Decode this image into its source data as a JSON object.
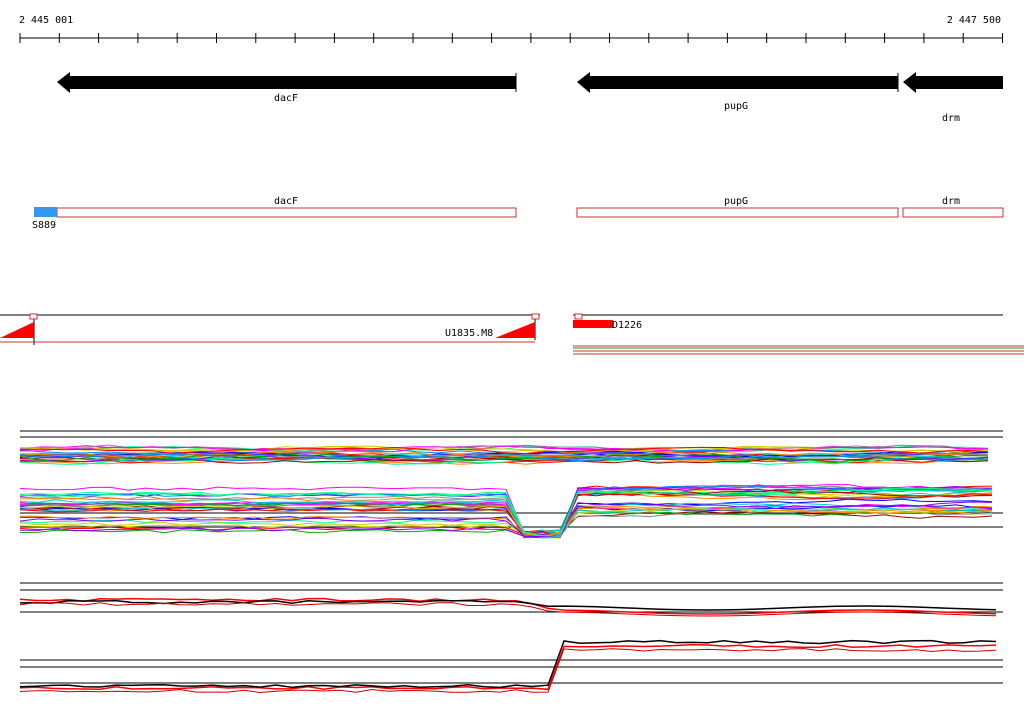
{
  "ruler": {
    "start_label": "2 445 001",
    "end_label": "2 447 500"
  },
  "genes": [
    {
      "name": "dacF",
      "strand": "-"
    },
    {
      "name": "pupG",
      "strand": "-"
    },
    {
      "name": "drm",
      "strand": "-"
    }
  ],
  "features": [
    {
      "label": "dacF",
      "color": "#cc3333"
    },
    {
      "label": "pupG",
      "color": "#cc3333"
    },
    {
      "label": "drm",
      "color": "#cc3333"
    }
  ],
  "promoter": {
    "label": "S889",
    "color": "#3399ee"
  },
  "elements": [
    {
      "label": "U1835.M8",
      "color": "#ff0000"
    },
    {
      "label": "D1226",
      "color": "#ff0000"
    }
  ],
  "colors": {
    "gene_arrow": "#000000",
    "feature_outline": "#cc3333",
    "promoter": "#3399ee",
    "element": "#ff0000",
    "track_palette": [
      "#ff0000",
      "#00aa00",
      "#0000ff",
      "#ff00ff",
      "#00cccc",
      "#cccc00",
      "#ff8800",
      "#8800ff",
      "#00ff88",
      "#888888",
      "#aa0000",
      "#0088ff"
    ]
  }
}
